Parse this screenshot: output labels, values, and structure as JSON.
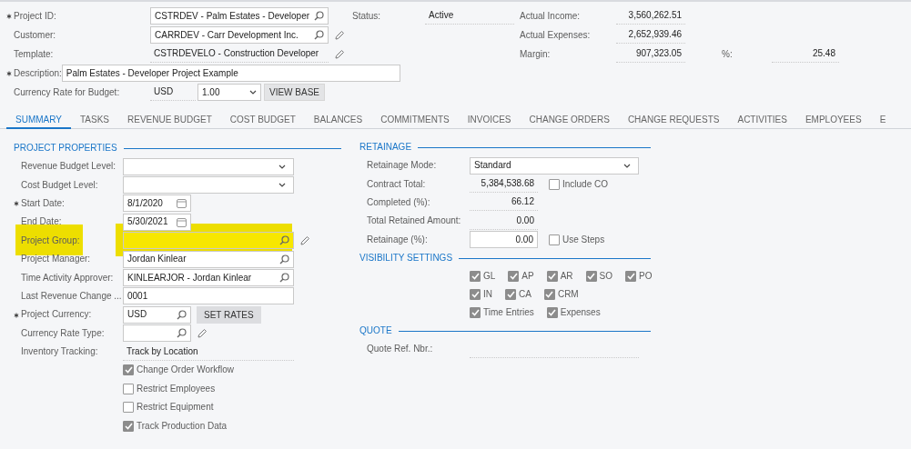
{
  "header": {
    "fields": [
      {
        "label": "Project ID:",
        "required": true,
        "kind": "lookup",
        "value": "CSTRDEV - Palm Estates - Developer",
        "edit": false
      },
      {
        "label": "Customer:",
        "required": false,
        "kind": "lookup",
        "value": "CARRDEV - Carr Development Inc.",
        "edit": true
      },
      {
        "label": "Template:",
        "required": false,
        "kind": "display",
        "value": "CSTRDEVELO - Construction Developer",
        "edit": true
      },
      {
        "label": "Description:",
        "required": true,
        "kind": "wide",
        "value": "Palm Estates - Developer Project Example",
        "edit": false
      },
      {
        "label": "Currency Rate for Budget:",
        "required": false,
        "kind": "currency",
        "value": "USD",
        "rate": "1.00",
        "button": "VIEW BASE",
        "edit": false
      }
    ],
    "status": {
      "label": "Status:",
      "value": "Active"
    },
    "totals": [
      {
        "label": "Actual Income:",
        "value": "3,560,262.51"
      },
      {
        "label": "Actual Expenses:",
        "value": "2,652,939.46"
      },
      {
        "label": "Margin:",
        "value": "907,323.05",
        "extra_label": "%:",
        "extra_value": "25.48"
      }
    ]
  },
  "tabs": [
    {
      "label": "SUMMARY",
      "selected": true
    },
    {
      "label": "TASKS",
      "selected": false
    },
    {
      "label": "REVENUE BUDGET",
      "selected": false
    },
    {
      "label": "COST BUDGET",
      "selected": false
    },
    {
      "label": "BALANCES",
      "selected": false
    },
    {
      "label": "COMMITMENTS",
      "selected": false
    },
    {
      "label": "INVOICES",
      "selected": false
    },
    {
      "label": "CHANGE ORDERS",
      "selected": false
    },
    {
      "label": "CHANGE REQUESTS",
      "selected": false
    },
    {
      "label": "ACTIVITIES",
      "selected": false
    },
    {
      "label": "EMPLOYEES",
      "selected": false
    },
    {
      "label": "E",
      "selected": false
    }
  ],
  "properties": {
    "title": "PROJECT PROPERTIES",
    "rows": [
      {
        "kind": "select",
        "label": "Revenue Budget Level:",
        "required": false
      },
      {
        "kind": "select",
        "label": "Cost Budget Level:",
        "required": false
      },
      {
        "kind": "date",
        "label": "Start Date:",
        "required": true,
        "value": "8/1/2020"
      },
      {
        "kind": "date",
        "label": "End Date:",
        "required": false,
        "value": "5/30/2021"
      },
      {
        "kind": "lookup",
        "label": "Project Group:",
        "required": false,
        "edit": true,
        "highlighted": true
      },
      {
        "kind": "lookup",
        "label": "Project Manager:",
        "required": false,
        "value": "Jordan Kinlear"
      },
      {
        "kind": "lookup",
        "label": "Time Activity Approver:",
        "required": false,
        "value": "KINLEARJOR - Jordan Kinlear"
      },
      {
        "kind": "text",
        "label": "Last Revenue Change ...",
        "required": false,
        "value": "0001"
      },
      {
        "kind": "short_lookup",
        "label": "Project Currency:",
        "required": true,
        "value": "USD",
        "button": "SET RATES"
      },
      {
        "kind": "short_lookup",
        "label": "Currency Rate Type:",
        "required": false,
        "edit": true
      },
      {
        "kind": "display",
        "label": "Inventory Tracking:",
        "required": false,
        "value": "Track by Location"
      },
      {
        "kind": "checkbox",
        "label": "Change Order Workflow",
        "checked": true
      },
      {
        "kind": "checkbox",
        "label": "Restrict Employees",
        "checked": false
      },
      {
        "kind": "checkbox",
        "label": "Restrict Equipment",
        "checked": false
      },
      {
        "kind": "checkbox",
        "label": "Track Production Data",
        "checked": true
      }
    ]
  },
  "retainage": {
    "title": "RETAINAGE",
    "rows": [
      {
        "kind": "select",
        "label": "Retainage Mode:",
        "value": "Standard"
      },
      {
        "kind": "number_display",
        "label": "Contract Total:",
        "value": "5,384,538.68",
        "check_label": "Include CO",
        "checked": false
      },
      {
        "kind": "number_display",
        "label": "Completed (%):",
        "value": "66.12"
      },
      {
        "kind": "number_display",
        "label": "Total Retained Amount:",
        "value": "0.00"
      },
      {
        "kind": "number_input",
        "label": "Retainage (%):",
        "value": "0.00",
        "check_label": "Use Steps",
        "checked": false
      }
    ]
  },
  "visibility": {
    "title": "VISIBILITY SETTINGS",
    "lines": [
      [
        {
          "label": "GL",
          "checked": true
        },
        {
          "label": "AP",
          "checked": true
        },
        {
          "label": "AR",
          "checked": true
        },
        {
          "label": "SO",
          "checked": true
        },
        {
          "label": "PO",
          "checked": true
        }
      ],
      [
        {
          "label": "IN",
          "checked": true
        },
        {
          "label": "CA",
          "checked": true
        },
        {
          "label": "CRM",
          "checked": true
        }
      ],
      [
        {
          "label": "Time Entries",
          "checked": true
        },
        {
          "label": "Expenses",
          "checked": true
        }
      ]
    ]
  },
  "quote": {
    "title": "QUOTE",
    "rows": [
      {
        "kind": "display",
        "label": "Quote Ref. Nbr.:"
      }
    ]
  }
}
